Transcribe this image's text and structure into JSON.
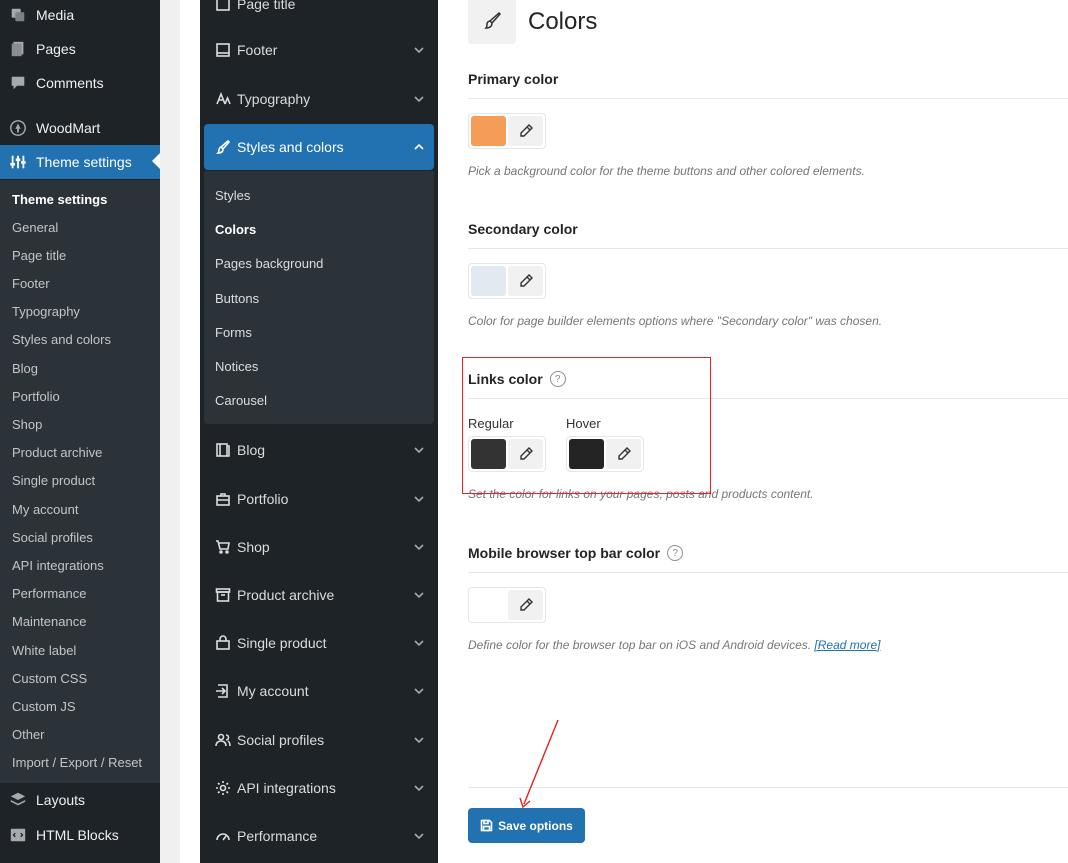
{
  "wp_menu": [
    {
      "label": "Media",
      "icon": "media-icon"
    },
    {
      "label": "Pages",
      "icon": "pages-icon"
    },
    {
      "label": "Comments",
      "icon": "comments-icon"
    },
    {
      "label": "WoodMart",
      "icon": "woodmart-icon"
    },
    {
      "label": "Theme settings",
      "icon": "sliders-icon"
    },
    {
      "label": "Layouts",
      "icon": "layers-icon"
    },
    {
      "label": "HTML Blocks",
      "icon": "code-icon"
    }
  ],
  "wp_submenu": [
    "Theme settings",
    "General",
    "Page title",
    "Footer",
    "Typography",
    "Styles and colors",
    "Blog",
    "Portfolio",
    "Shop",
    "Product archive",
    "Single product",
    "My account",
    "Social profiles",
    "API integrations",
    "Performance",
    "Maintenance",
    "White label",
    "Custom CSS",
    "Custom JS",
    "Other",
    "Import / Export / Reset"
  ],
  "ts_nav": {
    "top_partial": "Page title",
    "items": [
      {
        "label": "Footer",
        "icon": "footer-icon"
      },
      {
        "label": "Typography",
        "icon": "typography-icon"
      },
      {
        "label": "Styles and colors",
        "icon": "brush-icon"
      },
      {
        "label": "Blog",
        "icon": "blog-icon"
      },
      {
        "label": "Portfolio",
        "icon": "briefcase-icon"
      },
      {
        "label": "Shop",
        "icon": "cart-icon"
      },
      {
        "label": "Product archive",
        "icon": "archive-icon"
      },
      {
        "label": "Single product",
        "icon": "bag-icon"
      },
      {
        "label": "My account",
        "icon": "login-icon"
      },
      {
        "label": "Social profiles",
        "icon": "users-icon"
      },
      {
        "label": "API integrations",
        "icon": "gear-icon"
      },
      {
        "label": "Performance",
        "icon": "gauge-icon"
      }
    ],
    "sub_items": [
      "Styles",
      "Colors",
      "Pages background",
      "Buttons",
      "Forms",
      "Notices",
      "Carousel"
    ]
  },
  "main": {
    "title": "Colors",
    "primary": {
      "title": "Primary color",
      "color": "#f59c57",
      "desc": "Pick a background color for the theme buttons and other colored elements."
    },
    "secondary": {
      "title": "Secondary color",
      "color": "#e3e9f0",
      "desc": "Color for page builder elements options where \"Secondary color\" was chosen."
    },
    "links": {
      "title": "Links color",
      "regular_label": "Regular",
      "regular_color": "#333333",
      "hover_label": "Hover",
      "hover_color": "#242424",
      "desc": "Set the color for links on your pages, posts and products content."
    },
    "mobile": {
      "title": "Mobile browser top bar color",
      "color": "#ffffff",
      "desc": "Define color for the browser top bar on iOS and Android devices.",
      "link": "[Read more]"
    },
    "help_glyph": "?",
    "save_label": "Save options"
  },
  "accent_color": "#2271b1",
  "highlight_color": "#e22222"
}
